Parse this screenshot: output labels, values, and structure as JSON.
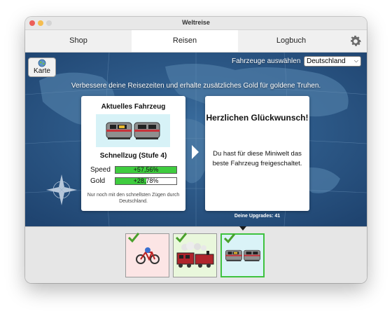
{
  "window": {
    "title": "Weltreise"
  },
  "tabs": [
    {
      "label": "Shop"
    },
    {
      "label": "Reisen"
    },
    {
      "label": "Logbuch"
    }
  ],
  "active_tab": "Reisen",
  "map": {
    "karte_button": {
      "label": "Karte"
    },
    "vehicle_select": {
      "label": "Fahrzeuge auswählen",
      "value": "Deutschland"
    },
    "banner": "Verbessere deine Reisezeiten und erhalte zusätzliches Gold für goldene Truhen."
  },
  "current_vehicle": {
    "title": "Aktuelles Fahrzeug",
    "name": "Schnellzug (Stufe 4)",
    "stats": [
      {
        "label": "Speed",
        "value_text": "+57,56%",
        "fill": 1.0
      },
      {
        "label": "Gold",
        "value_text": "+28,78%",
        "fill": 0.5
      }
    ],
    "note": "Nur noch mit den schnellsten Zügen durch Deutschland."
  },
  "congrats": {
    "title": "Herzlichen Glückwunsch!",
    "body": "Du hast für diese Miniwelt das beste Fahrzeug freigeschaltet."
  },
  "upgrades_text": "Deine Upgrades: 41",
  "vehicles": [
    {
      "name": "Fahrrad",
      "unlocked": true,
      "selected": false
    },
    {
      "name": "Dampflok",
      "unlocked": true,
      "selected": false
    },
    {
      "name": "Schnellzug",
      "unlocked": true,
      "selected": true
    }
  ],
  "colors": {
    "map_ocean": "#2d5b8c",
    "stat_green": "#3fcc3f",
    "selected_border": "#3fc23f",
    "check_green": "#4aa02c"
  },
  "icons": {
    "settings": "gear-icon",
    "map_button": "globe-icon",
    "check": "checkmark-icon"
  }
}
